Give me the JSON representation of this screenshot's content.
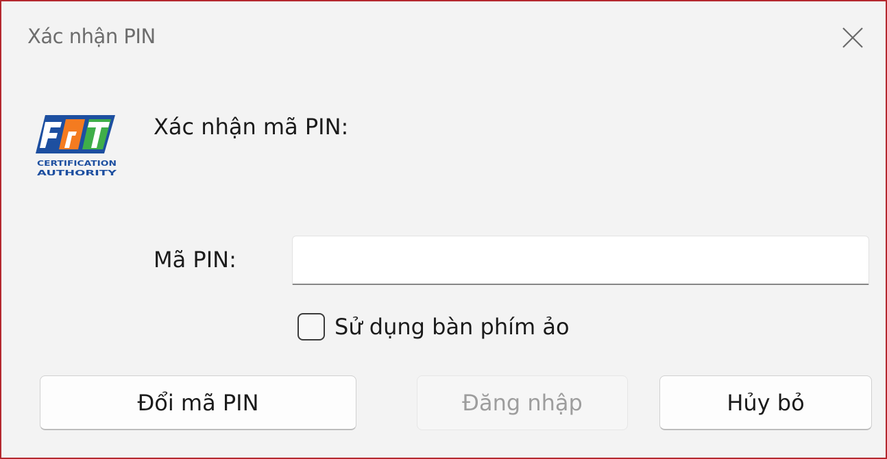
{
  "window": {
    "title": "Xác nhận PIN",
    "border_color": "#b4282e"
  },
  "title_bar": {
    "close_icon": "close-icon"
  },
  "logo": {
    "icon": "fpt-ca-logo",
    "lines": [
      "CERTIFICATION",
      "AUTHORITY"
    ],
    "colors": {
      "blue": "#1d4fa0",
      "orange": "#f47b20",
      "green": "#3fae49"
    }
  },
  "form": {
    "prompt": "Xác nhận mã PIN:",
    "pin_label": "Mã PIN:",
    "pin_value": "",
    "virtual_keyboard_label": "Sử dụng bàn phím ảo",
    "virtual_keyboard_checked": false
  },
  "buttons": {
    "change_pin": "Đổi mã PIN",
    "login": "Đăng nhập",
    "login_enabled": false,
    "cancel": "Hủy bỏ"
  }
}
